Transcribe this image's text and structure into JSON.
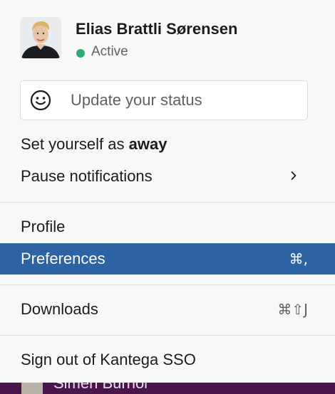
{
  "user": {
    "name": "Elias Brattli Sørensen",
    "status": "Active",
    "status_color": "#2bac76"
  },
  "status_input": {
    "placeholder": "Update your status",
    "icon": "smiley-icon"
  },
  "menu": {
    "set_away_prefix": "Set yourself as ",
    "set_away_bold": "away",
    "pause_notifications": "Pause notifications",
    "pause_notifications_icon": "chevron-right-icon",
    "profile": "Profile",
    "preferences": "Preferences",
    "preferences_shortcut": "⌘,",
    "downloads": "Downloads",
    "downloads_shortcut": "⌘⇧J",
    "sign_out": "Sign out of Kantega SSO"
  },
  "background": {
    "peek_name": "Simen Burhol"
  },
  "colors": {
    "highlight": "#2c63a2",
    "menu_bg": "#f8f8f8",
    "sidebar_bg": "#4a154b"
  }
}
